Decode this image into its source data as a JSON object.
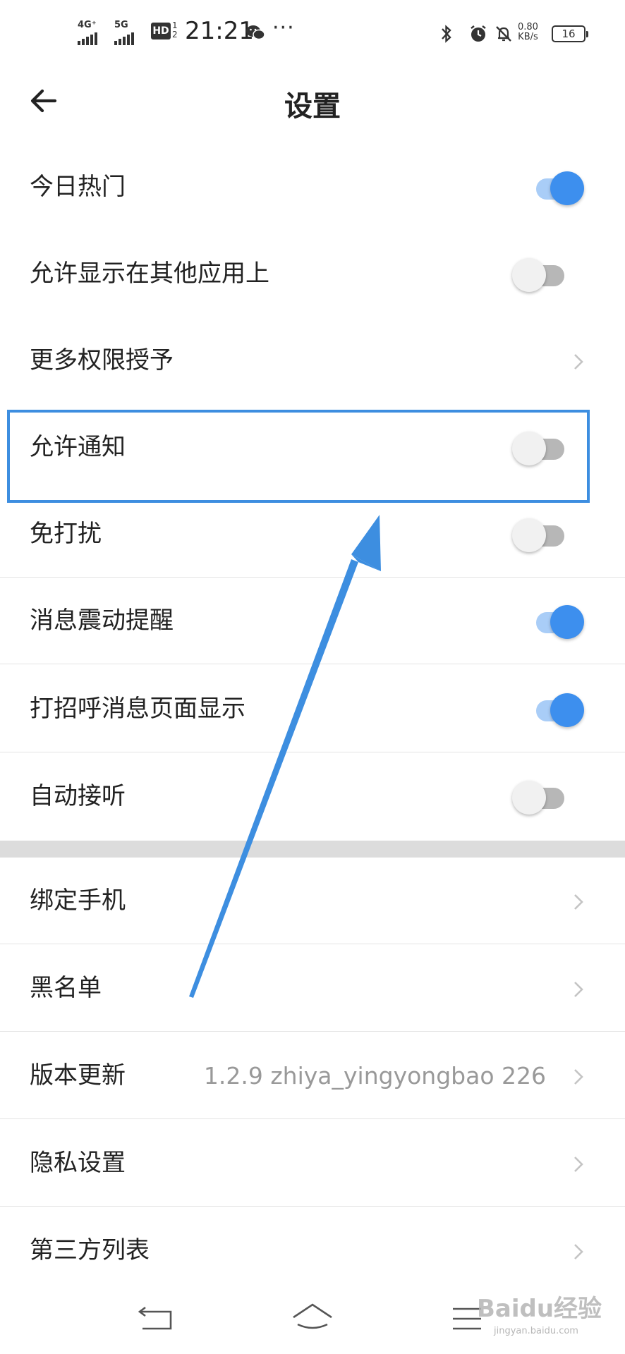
{
  "status_bar": {
    "network_1": "4G⁺",
    "network_2": "5G",
    "hd_label": "HD",
    "hd_sub_1": "1",
    "hd_sub_2": "2",
    "time": "21:21",
    "more": "···",
    "speed_value": "0.80",
    "speed_unit": "KB/s",
    "battery": "16",
    "icons": [
      "signal-icon",
      "wechat-icon",
      "bluetooth-icon",
      "alarm-icon",
      "mute-icon",
      "battery-icon"
    ]
  },
  "header": {
    "title": "设置",
    "back_icon": "back-arrow-icon"
  },
  "settings": {
    "group1": [
      {
        "label": "今日热门",
        "control": "toggle",
        "on": true
      },
      {
        "label": "允许显示在其他应用上",
        "control": "toggle",
        "on": false
      },
      {
        "label": "更多权限授予",
        "control": "chevron"
      },
      {
        "label": "允许通知",
        "control": "toggle",
        "on": false,
        "highlighted": true
      },
      {
        "label": "免打扰",
        "control": "toggle",
        "on": false
      },
      {
        "label": "消息震动提醒",
        "control": "toggle",
        "on": true
      },
      {
        "label": "打招呼消息页面显示",
        "control": "toggle",
        "on": true
      },
      {
        "label": "自动接听",
        "control": "toggle",
        "on": false
      }
    ],
    "group2": [
      {
        "label": "绑定手机",
        "control": "chevron"
      },
      {
        "label": "黑名单",
        "control": "chevron"
      },
      {
        "label": "版本更新",
        "control": "chevron",
        "value": "1.2.9 zhiya_yingyongbao 226"
      },
      {
        "label": "隐私设置",
        "control": "chevron"
      },
      {
        "label": "第三方列表",
        "control": "chevron"
      }
    ]
  },
  "colors": {
    "accent": "#3d8fee",
    "toggle_track_on": "#a9cdf7",
    "toggle_track_off": "#b7b7b7",
    "annotation": "#3d8ee0",
    "section_gap": "#dcdcdc"
  },
  "nav": {
    "icons": [
      "back-nav-icon",
      "home-nav-icon",
      "menu-nav-icon"
    ]
  },
  "watermark": {
    "text": "Baidu经验",
    "sub": "jingyan.baidu.com"
  }
}
